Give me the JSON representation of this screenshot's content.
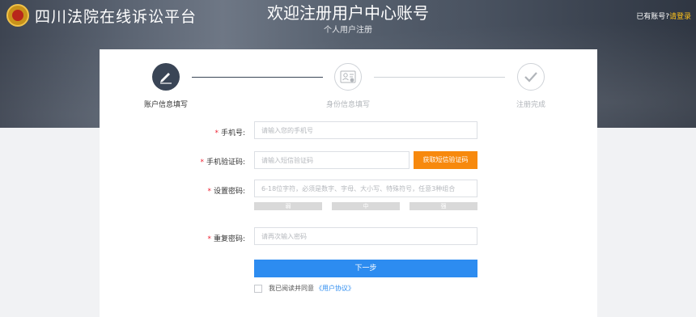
{
  "header": {
    "site_title": "四川法院在线诉讼平台",
    "page_title": "欢迎注册用户中心账号",
    "subtitle": "个人用户注册",
    "login_prompt": "已有账号?",
    "login_link": "请登录"
  },
  "steps": [
    {
      "label": "账户信息填写",
      "state": "active",
      "icon": "pen-icon"
    },
    {
      "label": "身份信息填写",
      "state": "inactive",
      "icon": "id-card-icon"
    },
    {
      "label": "注册完成",
      "state": "inactive",
      "icon": "check-icon"
    }
  ],
  "form": {
    "phone": {
      "label": "手机号:",
      "placeholder": "请输入您的手机号",
      "value": ""
    },
    "sms_code": {
      "label": "手机验证码:",
      "placeholder": "请输入短信验证码",
      "value": "",
      "button": "获取短信验证码"
    },
    "password": {
      "label": "设置密码:",
      "placeholder": "6-18位字符，必须是数字、字母、大小写、特殊符号，任意3种组合",
      "value": ""
    },
    "strength": [
      "弱",
      "中",
      "强"
    ],
    "confirm": {
      "label": "重复密码:",
      "placeholder": "请再次输入密码",
      "value": ""
    },
    "next": "下一步",
    "agree_text": "我已阅读并同意",
    "agree_link": "《用户协议》"
  },
  "colors": {
    "accent": "#2d8cf0",
    "orange": "#f7890d",
    "gold": "#ffc21a",
    "step_active": "#3a4556"
  }
}
